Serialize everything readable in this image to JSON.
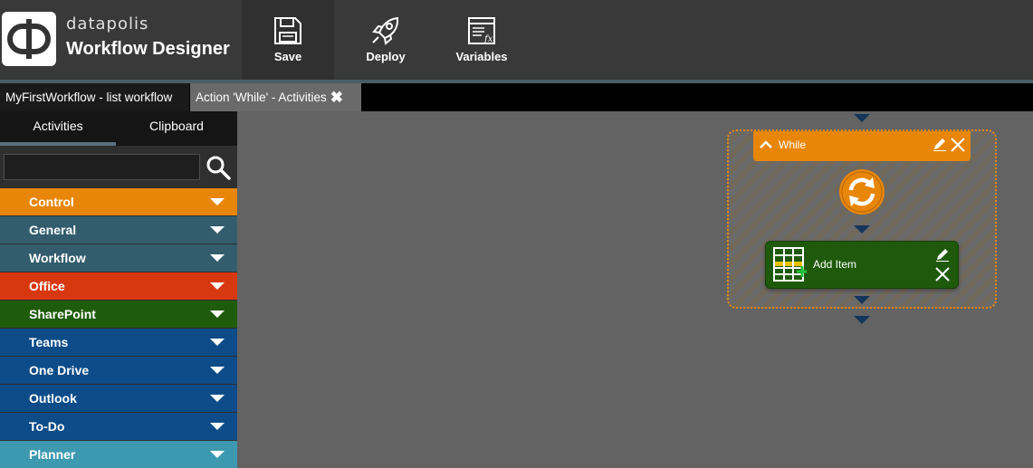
{
  "header": {
    "brand": "datapolis",
    "title": "Workflow Designer",
    "tools": {
      "save": {
        "label": "Save",
        "icon": "floppy-disk-icon"
      },
      "deploy": {
        "label": "Deploy",
        "icon": "rocket-icon"
      },
      "variables": {
        "label": "Variables",
        "icon": "variables-fx-icon"
      }
    }
  },
  "tabs": [
    {
      "label": "MyFirstWorkflow - list workflow"
    },
    {
      "label": "Action 'While' - Activities",
      "close": "✖"
    }
  ],
  "sidebar": {
    "tabs": [
      {
        "label": "Activities"
      },
      {
        "label": "Clipboard"
      }
    ],
    "search": {
      "value": "",
      "placeholder": ""
    },
    "categories": [
      {
        "label": "Control",
        "color": "#e8860a"
      },
      {
        "label": "General",
        "color": "#335d6d"
      },
      {
        "label": "Workflow",
        "color": "#335d6d"
      },
      {
        "label": "Office",
        "color": "#d7380f"
      },
      {
        "label": "SharePoint",
        "color": "#1e5c0b"
      },
      {
        "label": "Teams",
        "color": "#0d4c88"
      },
      {
        "label": "One Drive",
        "color": "#0d4c88"
      },
      {
        "label": "Outlook",
        "color": "#0d4c88"
      },
      {
        "label": "To-Do",
        "color": "#0d4c88"
      },
      {
        "label": "Planner",
        "color": "#3d99b0"
      }
    ]
  },
  "canvas": {
    "while_block": {
      "label": "While",
      "color": "#e8860a"
    },
    "add_item": {
      "label": "Add Item",
      "color": "#1f5a0c"
    }
  }
}
